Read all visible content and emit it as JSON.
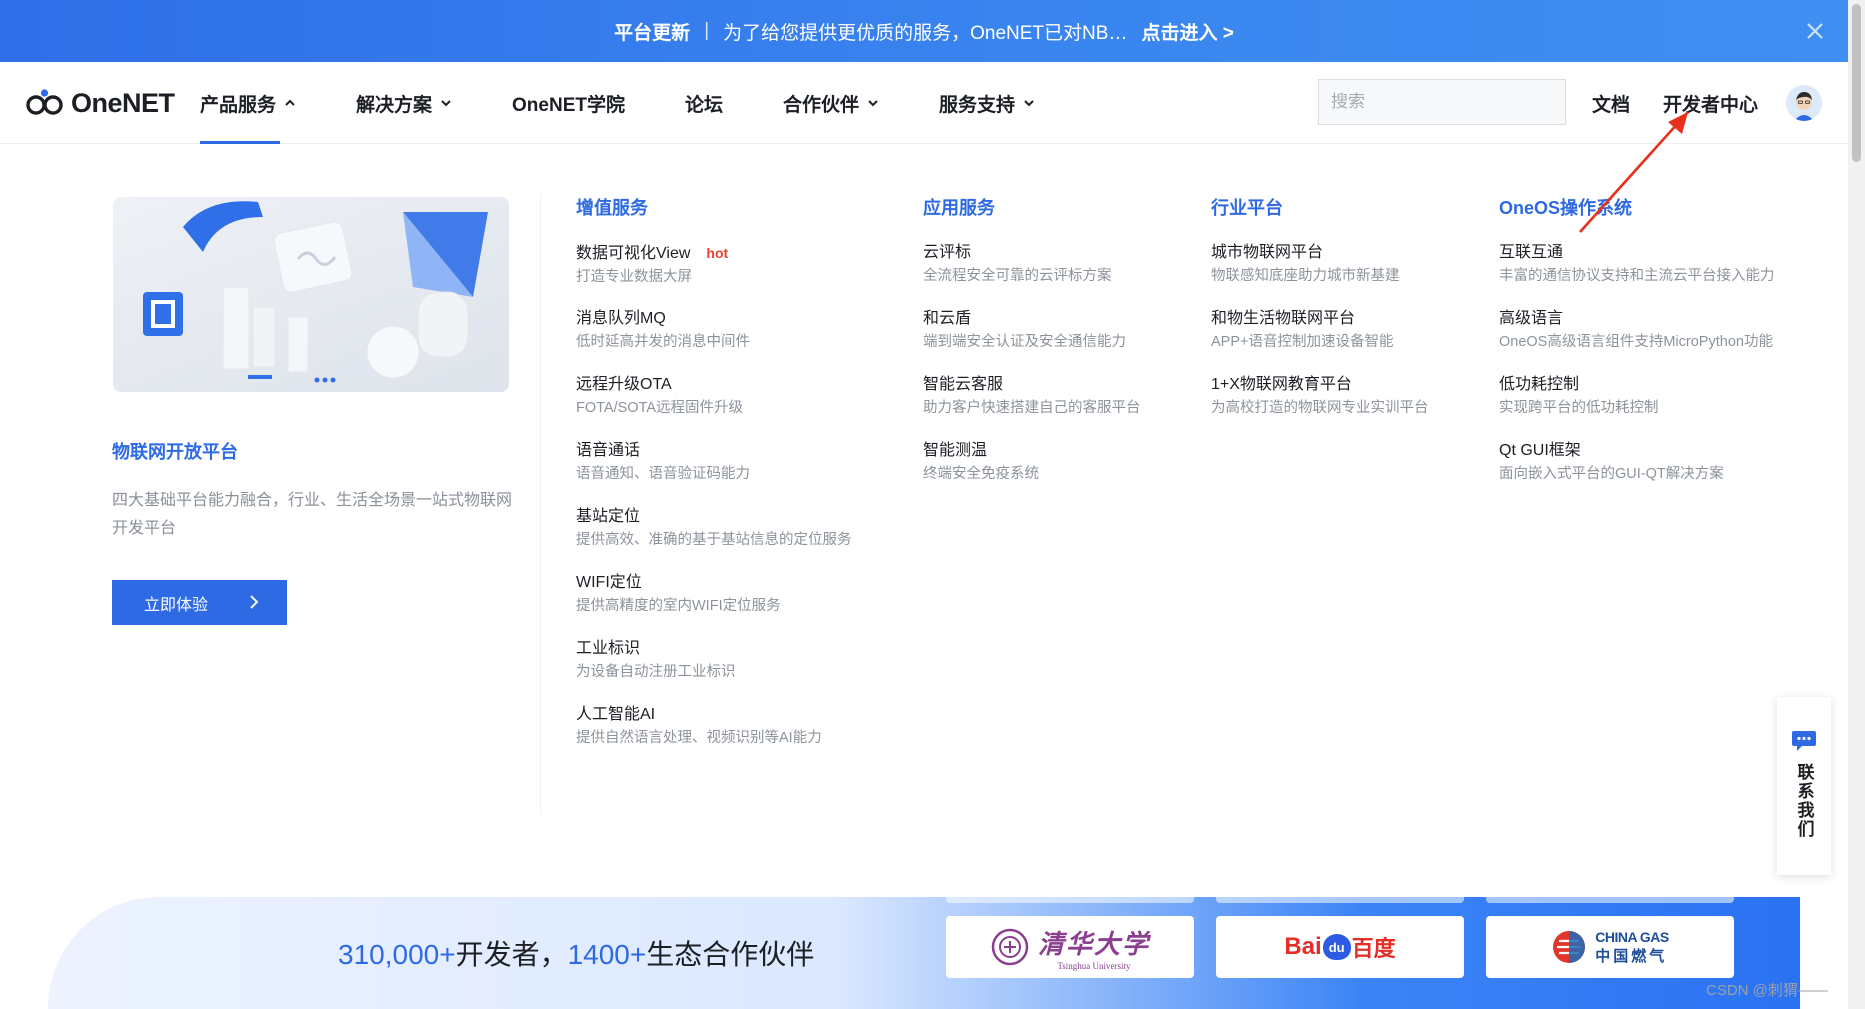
{
  "announcement": {
    "tag": "平台更新",
    "message": "为了给您提供更优质的服务，OneNET已对NB…",
    "cta": "点击进入 >"
  },
  "nav": {
    "logo_text": "OneNET",
    "menu": [
      {
        "label": "产品服务",
        "has_chevron": true,
        "active": true
      },
      {
        "label": "解决方案",
        "has_chevron": true
      },
      {
        "label": "OneNET学院"
      },
      {
        "label": "论坛"
      },
      {
        "label": "合作伙伴",
        "has_chevron": true
      },
      {
        "label": "服务支持",
        "has_chevron": true
      }
    ],
    "search_placeholder": "搜索",
    "docs_label": "文档",
    "developer_center_label": "开发者中心"
  },
  "promo": {
    "title": "物联网开放平台",
    "desc": "四大基础平台能力融合，行业、生活全场景一站式物联网开发平台",
    "button_label": "立即体验"
  },
  "columns": [
    {
      "title": "增值服务",
      "items": [
        {
          "name": "数据可视化View",
          "badge": "hot",
          "desc": "打造专业数据大屏"
        },
        {
          "name": "消息队列MQ",
          "desc": "低时延高并发的消息中间件"
        },
        {
          "name": "远程升级OTA",
          "desc": "FOTA/SOTA远程固件升级"
        },
        {
          "name": "语音通话",
          "desc": "语音通知、语音验证码能力"
        },
        {
          "name": "基站定位",
          "desc": "提供高效、准确的基于基站信息的定位服务"
        },
        {
          "name": "WIFI定位",
          "desc": "提供高精度的室内WIFI定位服务"
        },
        {
          "name": "工业标识",
          "desc": "为设备自动注册工业标识"
        },
        {
          "name": "人工智能AI",
          "desc": "提供自然语言处理、视频识别等AI能力"
        }
      ]
    },
    {
      "title": "应用服务",
      "items": [
        {
          "name": "云评标",
          "desc": "全流程安全可靠的云评标方案"
        },
        {
          "name": "和云盾",
          "desc": "端到端安全认证及安全通信能力"
        },
        {
          "name": "智能云客服",
          "desc": "助力客户快速搭建自己的客服平台"
        },
        {
          "name": "智能测温",
          "desc": "终端安全免疫系统"
        }
      ]
    },
    {
      "title": "行业平台",
      "items": [
        {
          "name": "城市物联网平台",
          "desc": "物联感知底座助力城市新基建"
        },
        {
          "name": "和物生活物联网平台",
          "desc": "APP+语音控制加速设备智能"
        },
        {
          "name": "1+X物联网教育平台",
          "desc": "为高校打造的物联网专业实训平台"
        }
      ]
    },
    {
      "title": "OneOS操作系统",
      "items": [
        {
          "name": "互联互通",
          "desc": "丰富的通信协议支持和主流云平台接入能力"
        },
        {
          "name": "高级语言",
          "desc": "OneOS高级语言组件支持MicroPython功能"
        },
        {
          "name": "低功耗控制",
          "desc": "实现跨平台的低功耗控制"
        },
        {
          "name": "Qt GUI框架",
          "desc": "面向嵌入式平台的GUI-QT解决方案"
        }
      ]
    }
  ],
  "band": {
    "dev_count": "310,000+",
    "dev_label": "开发者，",
    "partner_count": "1400+",
    "partner_label": "生态合作伙伴",
    "partners": [
      {
        "name": "清华大学",
        "sub": "Tsinghua University"
      },
      {
        "name": "百度",
        "latin": "Bai",
        "mark": "du"
      },
      {
        "name": "中国燃气",
        "latin": "CHINA GAS"
      }
    ]
  },
  "contact_label": "联系我们",
  "watermark": "CSDN @刺猬——",
  "colors": {
    "brand_blue": "#2d6ae3",
    "hot_red": "#e8412f",
    "annotation_red": "#e8301c"
  }
}
